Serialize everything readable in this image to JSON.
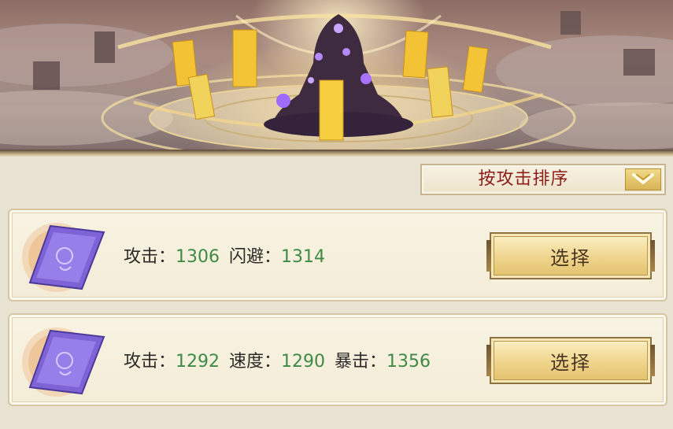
{
  "sort": {
    "label": "按攻击排序",
    "arrow_icon": "chevron-down-icon"
  },
  "items": [
    {
      "icon": "purple-scroll-icon",
      "stats": [
        {
          "label": "攻击：",
          "value": "1306"
        },
        {
          "label": "闪避：",
          "value": "1314"
        }
      ],
      "button_label": "选择"
    },
    {
      "icon": "purple-scroll-icon",
      "stats": [
        {
          "label": "攻击：",
          "value": "1292"
        },
        {
          "label": "速度：",
          "value": "1290"
        },
        {
          "label": "暴击：",
          "value": "1356"
        }
      ],
      "button_label": "选择"
    }
  ],
  "colors": {
    "stat_value": "#3f8a46",
    "sort_text": "#8b1e1a",
    "button_gold": "#efd48b"
  }
}
